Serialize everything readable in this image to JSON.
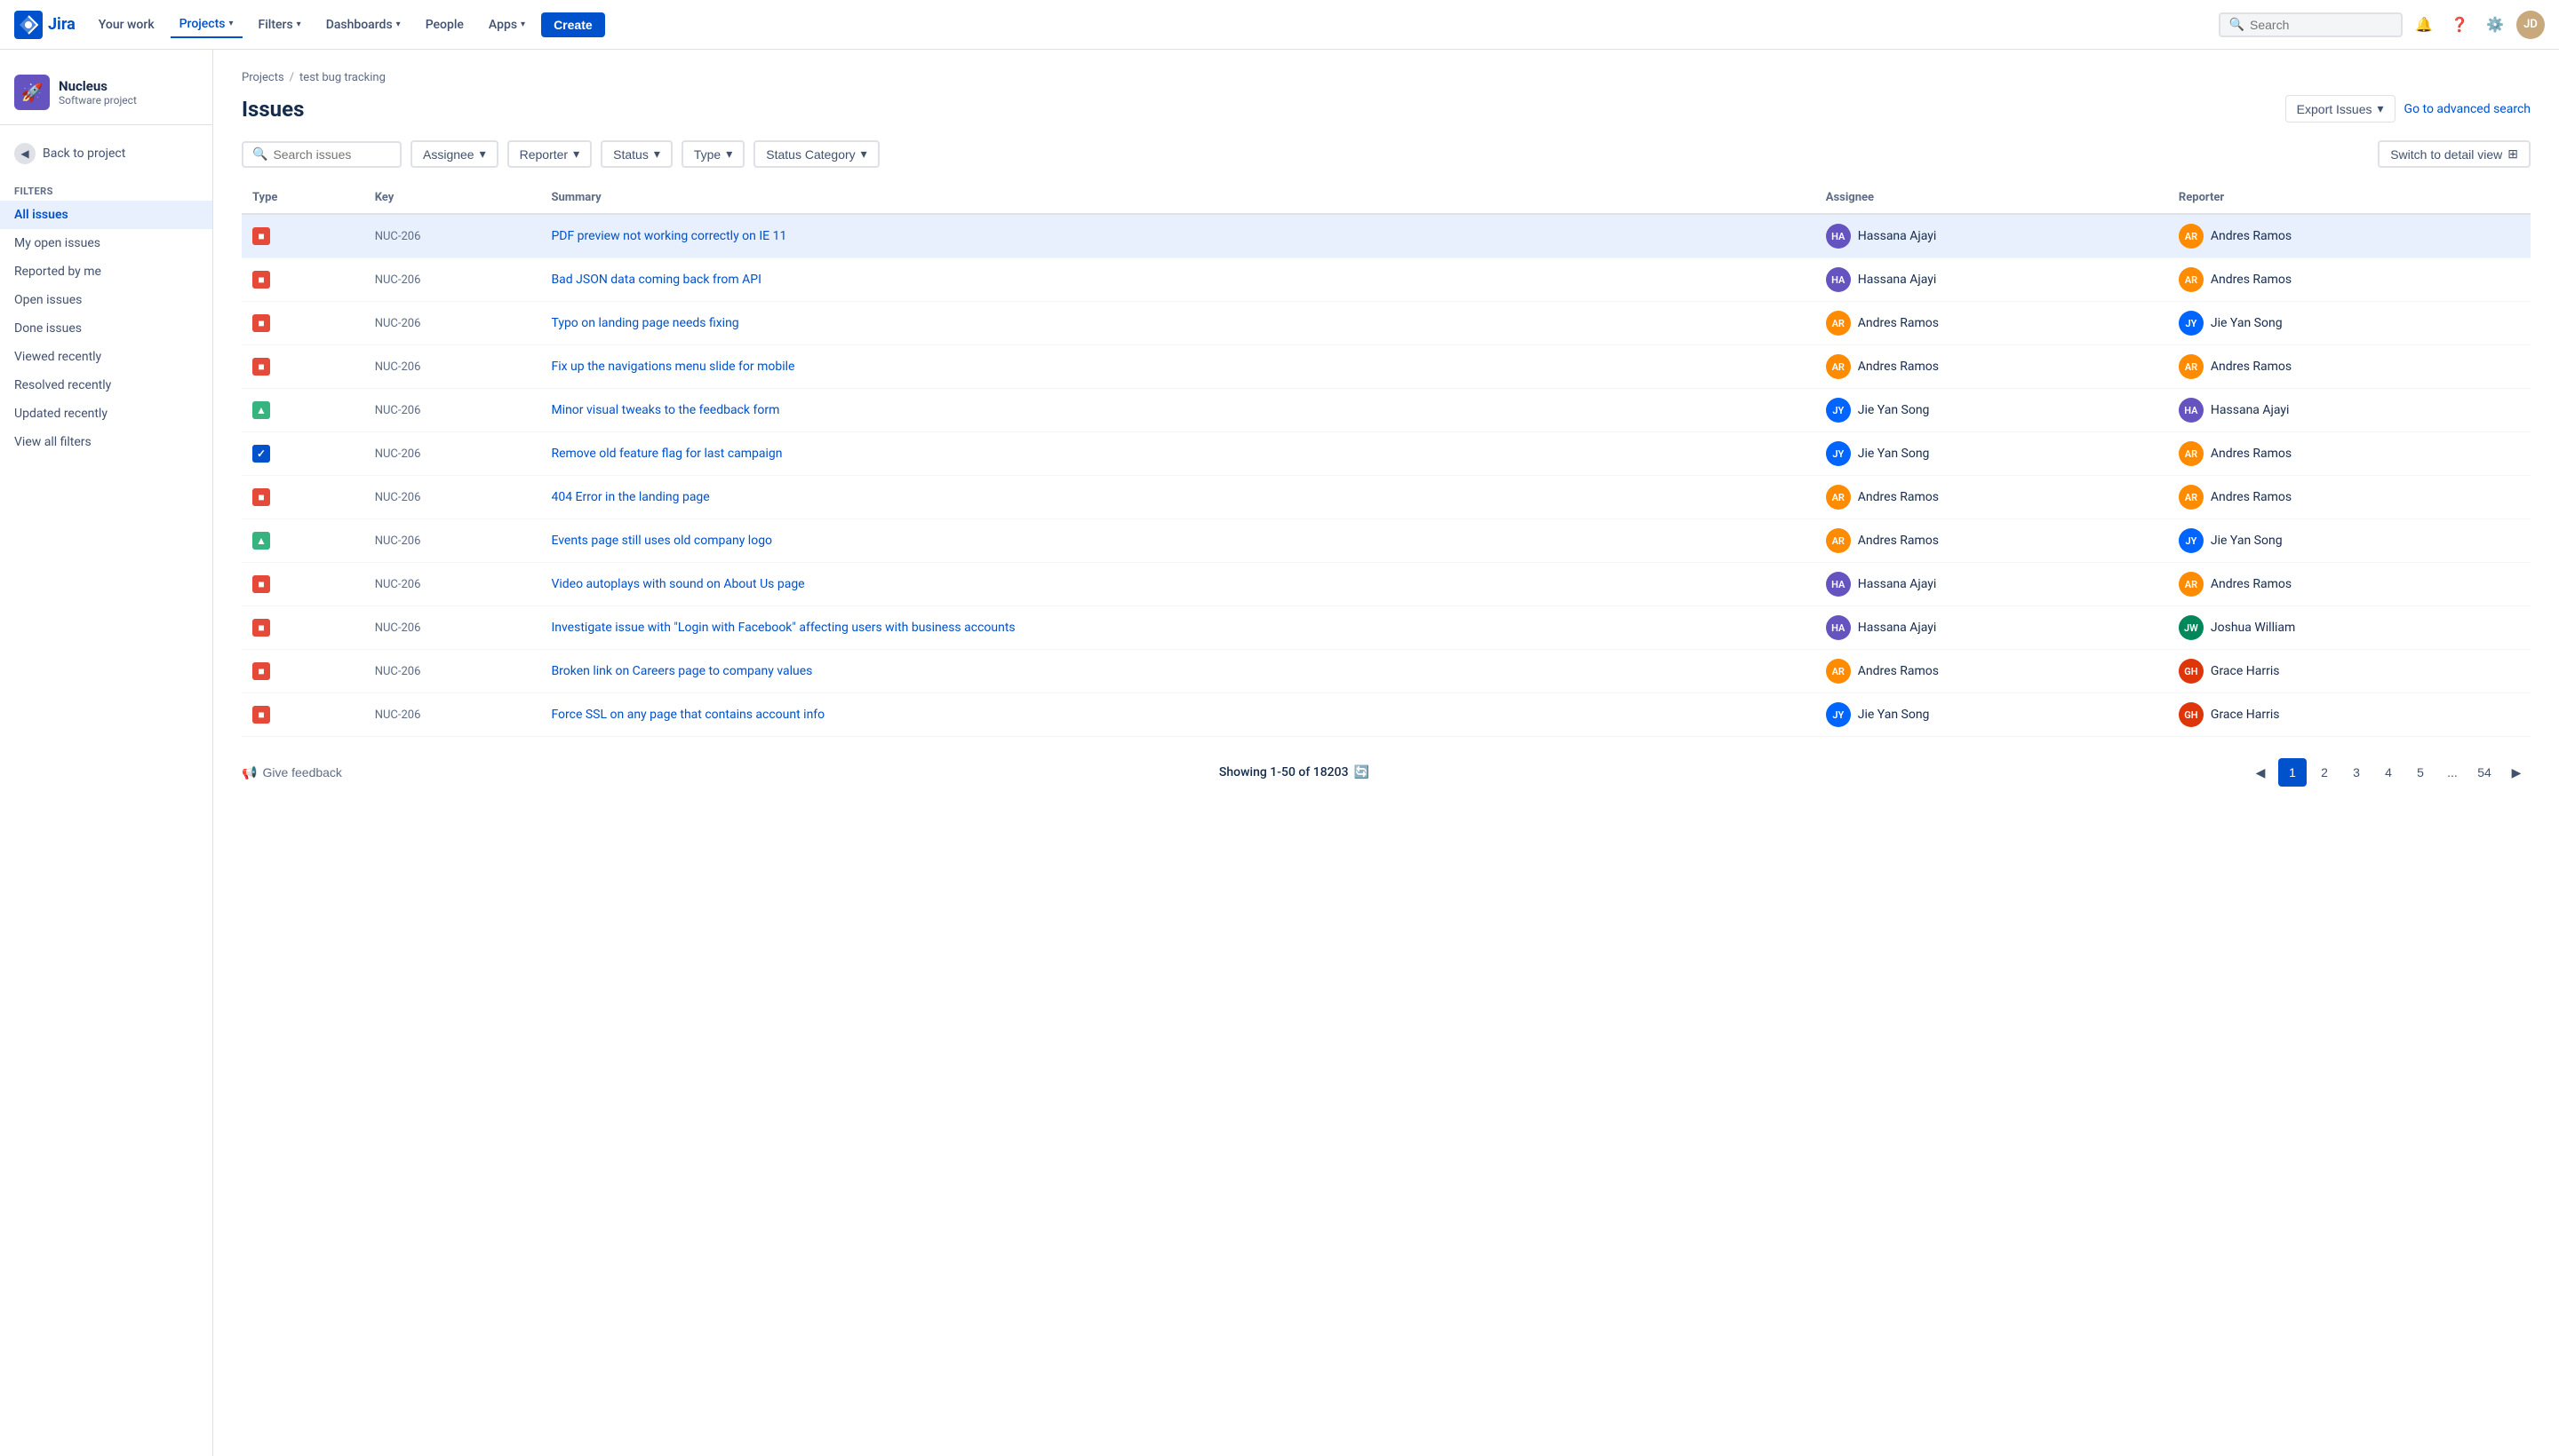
{
  "topnav": {
    "logo_text": "Jira",
    "items": [
      {
        "label": "Your work",
        "active": false
      },
      {
        "label": "Projects",
        "active": true,
        "has_chevron": true
      },
      {
        "label": "Filters",
        "active": false,
        "has_chevron": true
      },
      {
        "label": "Dashboards",
        "active": false,
        "has_chevron": true
      },
      {
        "label": "People",
        "active": false
      },
      {
        "label": "Apps",
        "active": false,
        "has_chevron": true
      }
    ],
    "create_label": "Create",
    "search_placeholder": "Search"
  },
  "sidebar": {
    "project_name": "Nucleus",
    "project_type": "Software project",
    "back_label": "Back to project",
    "section_title": "Filters",
    "items": [
      {
        "label": "All issues",
        "active": true
      },
      {
        "label": "My open issues",
        "active": false
      },
      {
        "label": "Reported by me",
        "active": false
      },
      {
        "label": "Open issues",
        "active": false
      },
      {
        "label": "Done issues",
        "active": false
      },
      {
        "label": "Viewed recently",
        "active": false
      },
      {
        "label": "Resolved recently",
        "active": false
      },
      {
        "label": "Updated recently",
        "active": false
      },
      {
        "label": "View all filters",
        "active": false
      }
    ]
  },
  "breadcrumb": {
    "items": [
      "Projects",
      "test bug tracking"
    ]
  },
  "page": {
    "title": "Issues",
    "export_label": "Export Issues",
    "adv_search_label": "Go to advanced search",
    "detail_view_label": "Switch to detail view"
  },
  "filters": {
    "search_placeholder": "Search issues",
    "buttons": [
      "Assignee",
      "Reporter",
      "Status",
      "Type",
      "Status Category"
    ]
  },
  "table": {
    "columns": [
      "Type",
      "Key",
      "Summary",
      "Assignee",
      "Reporter"
    ],
    "rows": [
      {
        "type": "bug",
        "key": "NUC-206",
        "summary": "PDF preview not working correctly on IE 11",
        "assignee": "Hassana Ajayi",
        "assignee_avatar": "ha",
        "reporter": "Andres Ramos",
        "reporter_avatar": "ar",
        "selected": true
      },
      {
        "type": "bug",
        "key": "NUC-206",
        "summary": "Bad JSON data coming back from API",
        "assignee": "Hassana Ajayi",
        "assignee_avatar": "ha",
        "reporter": "Andres Ramos",
        "reporter_avatar": "ar",
        "selected": false
      },
      {
        "type": "bug",
        "key": "NUC-206",
        "summary": "Typo on landing page needs fixing",
        "assignee": "Andres Ramos",
        "assignee_avatar": "ar",
        "reporter": "Jie Yan Song",
        "reporter_avatar": "jy",
        "selected": false
      },
      {
        "type": "bug",
        "key": "NUC-206",
        "summary": "Fix up the navigations menu slide for mobile",
        "assignee": "Andres Ramos",
        "assignee_avatar": "ar",
        "reporter": "Andres Ramos",
        "reporter_avatar": "ar",
        "selected": false
      },
      {
        "type": "improvement",
        "key": "NUC-206",
        "summary": "Minor visual tweaks to the feedback form",
        "assignee": "Jie Yan Song",
        "assignee_avatar": "jy",
        "reporter": "Hassana Ajayi",
        "reporter_avatar": "ha",
        "selected": false
      },
      {
        "type": "done",
        "key": "NUC-206",
        "summary": "Remove old feature flag for last campaign",
        "assignee": "Jie Yan Song",
        "assignee_avatar": "jy",
        "reporter": "Andres Ramos",
        "reporter_avatar": "ar",
        "selected": false
      },
      {
        "type": "bug",
        "key": "NUC-206",
        "summary": "404 Error in the landing page",
        "assignee": "Andres Ramos",
        "assignee_avatar": "ar",
        "reporter": "Andres Ramos",
        "reporter_avatar": "ar",
        "selected": false
      },
      {
        "type": "improvement",
        "key": "NUC-206",
        "summary": "Events page still uses old company logo",
        "assignee": "Andres Ramos",
        "assignee_avatar": "ar",
        "reporter": "Jie Yan Song",
        "reporter_avatar": "jy",
        "selected": false
      },
      {
        "type": "bug",
        "key": "NUC-206",
        "summary": "Video autoplays with sound on About Us page",
        "assignee": "Hassana Ajayi",
        "assignee_avatar": "ha",
        "reporter": "Andres Ramos",
        "reporter_avatar": "ar",
        "selected": false
      },
      {
        "type": "bug",
        "key": "NUC-206",
        "summary": "Investigate issue with \"Login with Facebook\" affecting users with business accounts",
        "assignee": "Hassana Ajayi",
        "assignee_avatar": "ha",
        "reporter": "Joshua William",
        "reporter_avatar": "jw",
        "selected": false
      },
      {
        "type": "bug",
        "key": "NUC-206",
        "summary": "Broken link on Careers page to company values",
        "assignee": "Andres Ramos",
        "assignee_avatar": "ar",
        "reporter": "Grace Harris",
        "reporter_avatar": "gh",
        "selected": false
      },
      {
        "type": "bug",
        "key": "NUC-206",
        "summary": "Force SSL on any page that contains account info",
        "assignee": "Jie Yan Song",
        "assignee_avatar": "jy",
        "reporter": "Grace Harris",
        "reporter_avatar": "gh",
        "selected": false
      }
    ]
  },
  "pagination": {
    "feedback_label": "Give feedback",
    "showing_text": "Showing 1-50 of 18203",
    "pages": [
      "1",
      "2",
      "3",
      "4",
      "5",
      "...",
      "54"
    ],
    "current_page": "1"
  },
  "avatars": {
    "ha_initials": "HA",
    "ar_initials": "AR",
    "jy_initials": "JY",
    "jw_initials": "JW",
    "gh_initials": "GH"
  }
}
